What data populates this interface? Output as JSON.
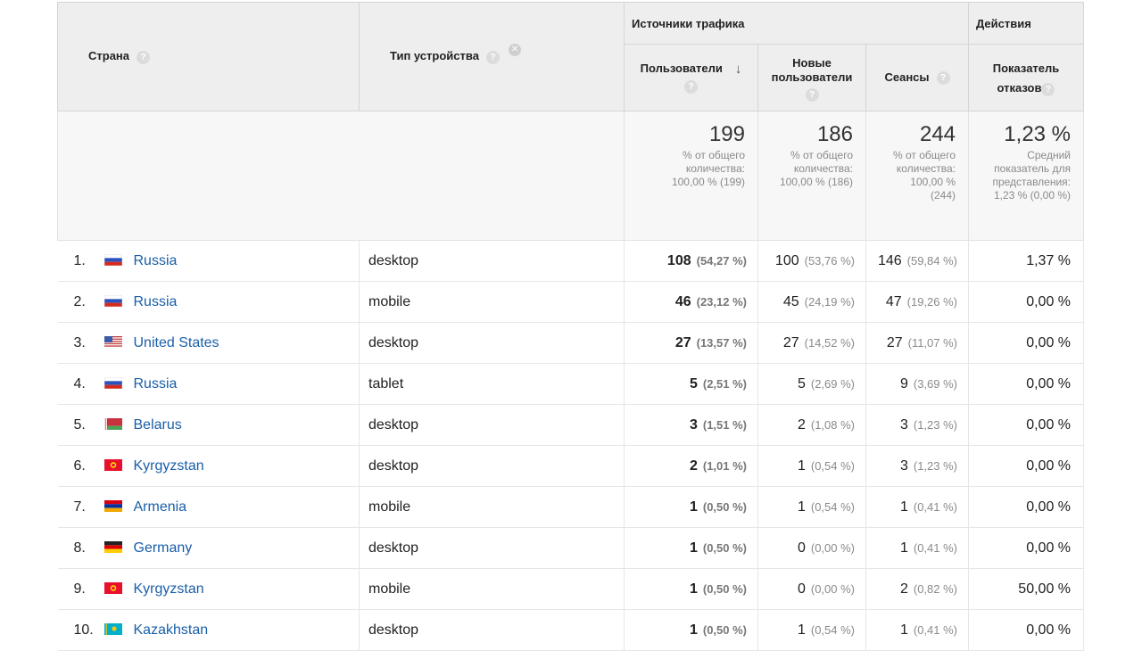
{
  "headers": {
    "country": "Страна",
    "device": "Тип устройства",
    "traffic_sources": "Источники трафика",
    "actions": "Действия",
    "users": "Пользователи",
    "new_users_line1": "Новые",
    "new_users_line2": "пользователи",
    "sessions": "Сеансы",
    "bounce_line1": "Показатель",
    "bounce_line2": "отказов",
    "help_symbol": "?",
    "remove_symbol": "✕",
    "sort_arrow": "↓"
  },
  "totals": {
    "users": {
      "value": "199",
      "line1": "% от общего",
      "line2": "количества:",
      "line3": "100,00 % (199)"
    },
    "new_users": {
      "value": "186",
      "line1": "% от общего",
      "line2": "количества:",
      "line3": "100,00 % (186)"
    },
    "sessions": {
      "value": "244",
      "line1": "% от общего",
      "line2": "количества:",
      "line3": "100,00 %",
      "line4": "(244)"
    },
    "bounce": {
      "value": "1,23 %",
      "line1": "Средний",
      "line2": "показатель для",
      "line3": "представления:",
      "line4": "1,23 % (0,00 %)"
    }
  },
  "rows": [
    {
      "rank": "1.",
      "country": "Russia",
      "flag": "russia",
      "device": "desktop",
      "users": "108",
      "users_pct": "(54,27 %)",
      "new_users": "100",
      "new_users_pct": "(53,76 %)",
      "sessions": "146",
      "sessions_pct": "(59,84 %)",
      "bounce": "1,37 %"
    },
    {
      "rank": "2.",
      "country": "Russia",
      "flag": "russia",
      "device": "mobile",
      "users": "46",
      "users_pct": "(23,12 %)",
      "new_users": "45",
      "new_users_pct": "(24,19 %)",
      "sessions": "47",
      "sessions_pct": "(19,26 %)",
      "bounce": "0,00 %"
    },
    {
      "rank": "3.",
      "country": "United States",
      "flag": "usa",
      "device": "desktop",
      "users": "27",
      "users_pct": "(13,57 %)",
      "new_users": "27",
      "new_users_pct": "(14,52 %)",
      "sessions": "27",
      "sessions_pct": "(11,07 %)",
      "bounce": "0,00 %"
    },
    {
      "rank": "4.",
      "country": "Russia",
      "flag": "russia",
      "device": "tablet",
      "users": "5",
      "users_pct": "(2,51 %)",
      "new_users": "5",
      "new_users_pct": "(2,69 %)",
      "sessions": "9",
      "sessions_pct": "(3,69 %)",
      "bounce": "0,00 %"
    },
    {
      "rank": "5.",
      "country": "Belarus",
      "flag": "belarus",
      "device": "desktop",
      "users": "3",
      "users_pct": "(1,51 %)",
      "new_users": "2",
      "new_users_pct": "(1,08 %)",
      "sessions": "3",
      "sessions_pct": "(1,23 %)",
      "bounce": "0,00 %"
    },
    {
      "rank": "6.",
      "country": "Kyrgyzstan",
      "flag": "kyrgyzstan",
      "device": "desktop",
      "users": "2",
      "users_pct": "(1,01 %)",
      "new_users": "1",
      "new_users_pct": "(0,54 %)",
      "sessions": "3",
      "sessions_pct": "(1,23 %)",
      "bounce": "0,00 %"
    },
    {
      "rank": "7.",
      "country": "Armenia",
      "flag": "armenia",
      "device": "mobile",
      "users": "1",
      "users_pct": "(0,50 %)",
      "new_users": "1",
      "new_users_pct": "(0,54 %)",
      "sessions": "1",
      "sessions_pct": "(0,41 %)",
      "bounce": "0,00 %"
    },
    {
      "rank": "8.",
      "country": "Germany",
      "flag": "germany",
      "device": "desktop",
      "users": "1",
      "users_pct": "(0,50 %)",
      "new_users": "0",
      "new_users_pct": "(0,00 %)",
      "sessions": "1",
      "sessions_pct": "(0,41 %)",
      "bounce": "0,00 %"
    },
    {
      "rank": "9.",
      "country": "Kyrgyzstan",
      "flag": "kyrgyzstan",
      "device": "mobile",
      "users": "1",
      "users_pct": "(0,50 %)",
      "new_users": "0",
      "new_users_pct": "(0,00 %)",
      "sessions": "2",
      "sessions_pct": "(0,82 %)",
      "bounce": "50,00 %"
    },
    {
      "rank": "10.",
      "country": "Kazakhstan",
      "flag": "kazakhstan",
      "device": "desktop",
      "users": "1",
      "users_pct": "(0,50 %)",
      "new_users": "1",
      "new_users_pct": "(0,54 %)",
      "sessions": "1",
      "sessions_pct": "(0,41 %)",
      "bounce": "0,00 %"
    }
  ],
  "colors": {
    "link": "#1a5fa8",
    "header_bg": "#eeeeee",
    "muted": "#8a8a8a"
  }
}
